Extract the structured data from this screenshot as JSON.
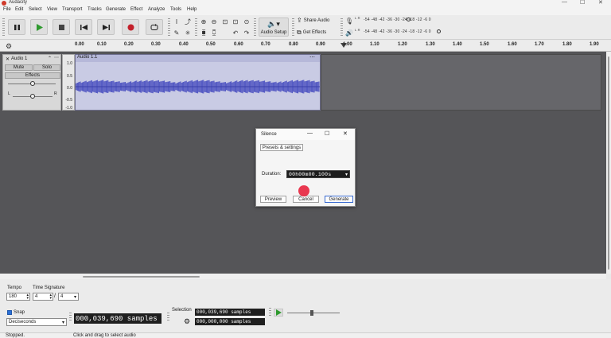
{
  "window": {
    "title": "Audacity",
    "minimize": "—",
    "maximize": "☐",
    "close": "✕"
  },
  "menu": [
    "File",
    "Edit",
    "Select",
    "View",
    "Transport",
    "Tracks",
    "Generate",
    "Effect",
    "Analyze",
    "Tools",
    "Help"
  ],
  "toolbar": {
    "audio_setup_label": "Audio Setup",
    "share_audio_label": "Share Audio",
    "get_effects_label": "Get Effects",
    "record_meter_scale": "-54 -48 -42 -36 -30 -24 -18 -12 -6 0",
    "play_meter_scale": "-54 -48 -42 -36 -30 -24 -18 -12 -6 0",
    "record_meter_channels": "L R",
    "play_meter_channels": "L R"
  },
  "ruler": {
    "ticks": [
      "0.00",
      "0.10",
      "0.20",
      "0.30",
      "0.40",
      "0.50",
      "0.60",
      "0.70",
      "0.80",
      "0.90",
      "1.00",
      "1.10",
      "1.20",
      "1.30",
      "1.40",
      "1.50",
      "1.60",
      "1.70",
      "1.80",
      "1.90"
    ]
  },
  "track": {
    "name": "Audio 1",
    "mute_label": "Mute",
    "solo_label": "Solo",
    "effects_label": "Effects",
    "pan_left": "L",
    "pan_right": "R",
    "clip_name": "Audio 1.1",
    "vruler": [
      "1.0",
      "0.5",
      "0.0",
      "-0.5",
      "-1.0"
    ],
    "accent_color": "#4a4fc0"
  },
  "dialog": {
    "title": "Silence",
    "presets_label": "Presets & settings",
    "duration_label": "Duration:",
    "duration_value": "00h00m00.100s",
    "preview_label": "Preview",
    "cancel_label": "Cancel",
    "generate_label": "Generate"
  },
  "bottom": {
    "tempo_label": "Tempo",
    "tempo_value": "180",
    "time_signature_label": "Time Signature",
    "ts_numerator": "4",
    "ts_denominator": "4",
    "ts_separator": "/",
    "snap_label": "Snap",
    "snap_unit": "Deciseconds",
    "selection_label": "Selection",
    "audio_position": "000,039,690 samples",
    "selection_start": "000,039,690 samples",
    "selection_end": "000,000,000 samples"
  },
  "status": {
    "state": "Stopped.",
    "hint": "Click and drag to select audio"
  }
}
